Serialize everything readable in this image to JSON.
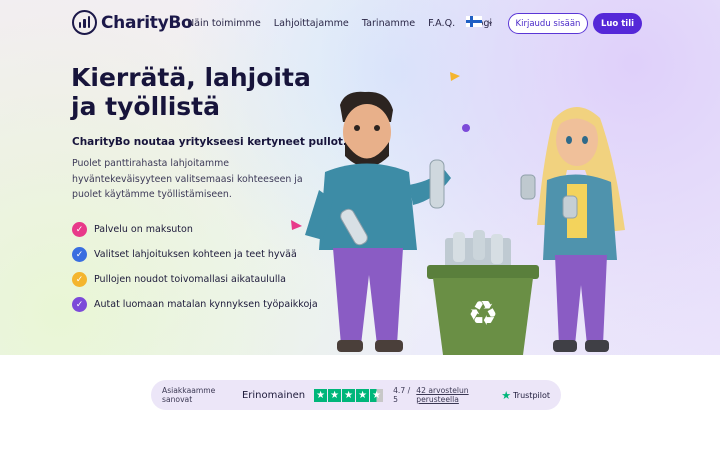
{
  "brand": {
    "name": "CharityBo"
  },
  "nav": {
    "items": [
      "Näin toimimme",
      "Lahjoittajamme",
      "Tarinamme",
      "F.A.Q.",
      "Blogi"
    ]
  },
  "language": {
    "icon": "finland-flag-icon",
    "chevron_icon": "chevron-down-icon"
  },
  "header_buttons": {
    "login": "Kirjaudu sisään",
    "signup": "Luo tili"
  },
  "hero": {
    "headline_line1": "Kierrätä, lahjoita",
    "headline_line2": "ja työllistä",
    "subheadline": "CharityBo noutaa yritykseesi kertyneet pullot.",
    "body": "Puolet panttirahasta lahjoitamme hyväntekeväisyyteen valitsemaasi kohteeseen ja puolet käytämme työllistämiseen.",
    "features": [
      {
        "label": "Palvelu on maksuton",
        "color": "#e8398a"
      },
      {
        "label": "Valitset lahjoituksen kohteen ja teet hyvää",
        "color": "#3a6ee0"
      },
      {
        "label": "Pullojen noudot toivomallasi aikataululla",
        "color": "#f4b52e"
      },
      {
        "label": "Autat luomaan matalan kynnyksen työpaikkoja",
        "color": "#7c4ad9"
      }
    ],
    "illustration_icon": "recycling-characters-illustration"
  },
  "trust": {
    "intro": "Asiakkaamme sanovat",
    "rating_word": "Erinomainen",
    "stars": 4.5,
    "score": "4.7 / 5",
    "reviews_link": "42 arvostelun perusteella",
    "provider": "Trustpilot",
    "provider_icon": "trustpilot-star-icon",
    "star_color": "#00b67a"
  },
  "colors": {
    "primary": "#5528d8",
    "dark": "#17143b"
  }
}
